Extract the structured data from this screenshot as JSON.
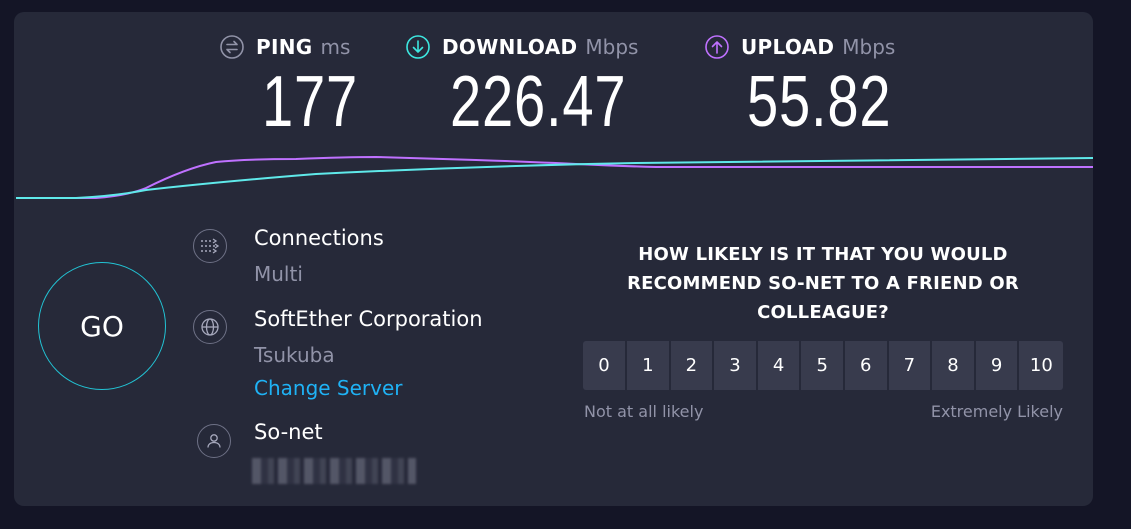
{
  "metrics": {
    "ping": {
      "name": "PING",
      "unit": "ms",
      "value": "177",
      "icon": "ping-icon",
      "color": "#9193a8"
    },
    "download": {
      "name": "DOWNLOAD",
      "unit": "Mbps",
      "value": "226.47",
      "icon": "download-icon",
      "color": "#3de7e0"
    },
    "upload": {
      "name": "UPLOAD",
      "unit": "Mbps",
      "value": "55.82",
      "icon": "upload-icon",
      "color": "#bf71ff"
    }
  },
  "go_button": {
    "label": "GO"
  },
  "connections": {
    "title": "Connections",
    "value": "Multi",
    "icon": "connections-icon"
  },
  "server": {
    "title": "SoftEther Corporation",
    "location": "Tsukuba",
    "change_label": "Change Server",
    "icon": "globe-icon"
  },
  "provider": {
    "title": "So-net",
    "icon": "user-icon"
  },
  "survey": {
    "question": "HOW LIKELY IS IT THAT YOU WOULD RECOMMEND SO-NET TO A FRIEND OR COLLEAGUE?",
    "scale": [
      "0",
      "1",
      "2",
      "3",
      "4",
      "5",
      "6",
      "7",
      "8",
      "9",
      "10"
    ],
    "low_label": "Not at all likely",
    "high_label": "Extremely Likely"
  },
  "colors": {
    "background": "#141526",
    "card": "#262939",
    "accent": "#22c3d4",
    "link": "#1fb2f5"
  }
}
